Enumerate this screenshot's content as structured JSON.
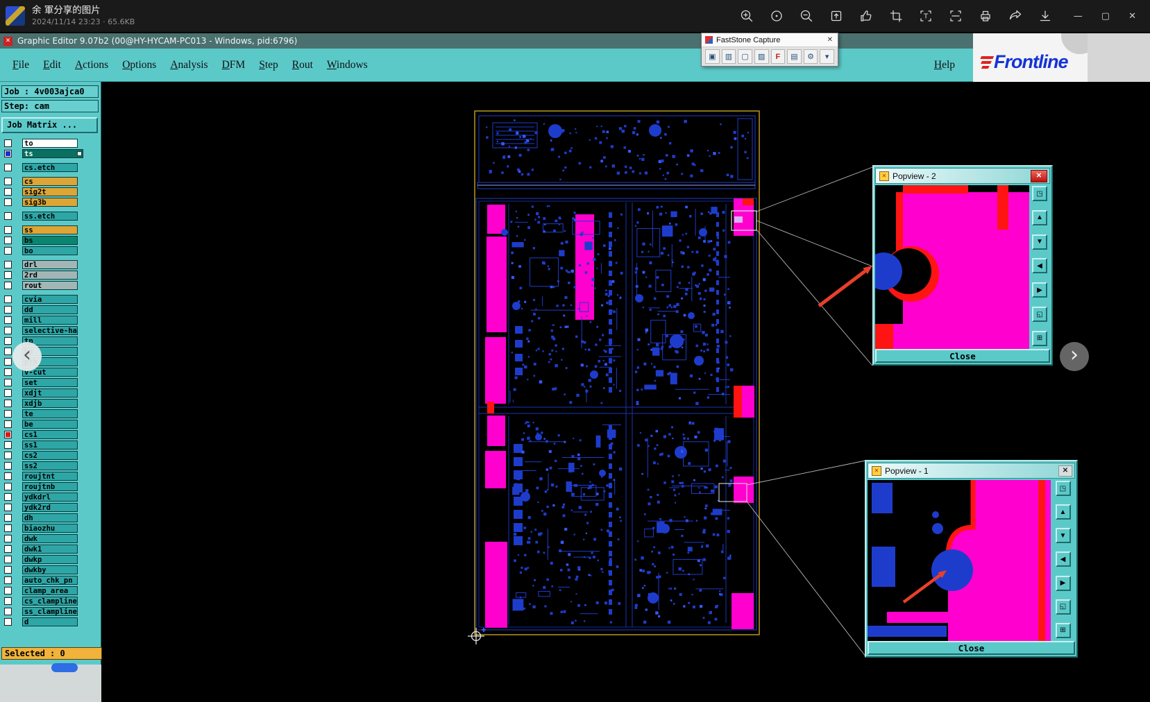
{
  "viewer": {
    "title": "余 軍分享的图片",
    "subtitle": "2024/11/14 23:23 · 65.6KB",
    "toolbar_icons": [
      "zoom-in",
      "actual-size",
      "zoom-out",
      "open-with",
      "thumbs-up",
      "crop",
      "ocr",
      "scan",
      "print",
      "share",
      "download"
    ],
    "window_buttons": [
      {
        "name": "minimize",
        "glyph": "—"
      },
      {
        "name": "maximize",
        "glyph": "▢"
      },
      {
        "name": "close",
        "glyph": "✕"
      }
    ],
    "nav_prev": "‹",
    "nav_next": "›"
  },
  "editor": {
    "titlebar": "Graphic Editor 9.07b2 (00@HY-HYCAM-PC013 - Windows, pid:6796)",
    "title_icon": "✕",
    "menus": [
      "File",
      "Edit",
      "Actions",
      "Options",
      "Analysis",
      "DFM",
      "Step",
      "Rout",
      "Windows"
    ],
    "help": "Help",
    "brand": "Frontline"
  },
  "faststone": {
    "title": "FastStone Capture",
    "close_glyph": "✕",
    "icons": [
      {
        "name": "capture-screen",
        "glyph": "▣"
      },
      {
        "name": "capture-window",
        "glyph": "▥"
      },
      {
        "name": "capture-region",
        "glyph": "▢"
      },
      {
        "name": "capture-freehand",
        "glyph": "▨"
      },
      {
        "name": "capture-fixed",
        "glyph": "F"
      },
      {
        "name": "save",
        "glyph": "▤"
      },
      {
        "name": "settings",
        "glyph": "⚙"
      },
      {
        "name": "more",
        "glyph": "▾"
      }
    ]
  },
  "sidebar": {
    "job_label": "Job : 4v003ajca0",
    "step_label": "Step: cam",
    "matrix_button": "Job Matrix ...",
    "selected_label": "Selected : 0",
    "layers": [
      {
        "n": "to",
        "c": "white"
      },
      {
        "n": "ts",
        "c": "sel",
        "cb": "blue"
      },
      {
        "n": "cs.etch",
        "c": "teal",
        "g": true
      },
      {
        "n": "cs",
        "c": "orange",
        "g": true
      },
      {
        "n": "sig2t",
        "c": "orange"
      },
      {
        "n": "sig3b",
        "c": "orange"
      },
      {
        "n": "ss.etch",
        "c": "teal",
        "g": true
      },
      {
        "n": "ss",
        "c": "orange",
        "g": true
      },
      {
        "n": "bs",
        "c": "green"
      },
      {
        "n": "bo",
        "c": "teal"
      },
      {
        "n": "drl",
        "c": "gray",
        "g": true
      },
      {
        "n": "2rd",
        "c": "gray"
      },
      {
        "n": "rout",
        "c": "gray"
      },
      {
        "n": "cvia",
        "c": "teal",
        "g": true
      },
      {
        "n": "dd",
        "c": "teal"
      },
      {
        "n": "mill",
        "c": "teal"
      },
      {
        "n": "selective-ha",
        "c": "teal"
      },
      {
        "n": "tp",
        "c": "teal"
      },
      {
        "n": "bp",
        "c": "teal"
      },
      {
        "n": "pth",
        "c": "teal"
      },
      {
        "n": "v-cut",
        "c": "teal"
      },
      {
        "n": "set",
        "c": "teal"
      },
      {
        "n": "xdjt",
        "c": "teal"
      },
      {
        "n": "xdjb",
        "c": "teal"
      },
      {
        "n": "te",
        "c": "teal"
      },
      {
        "n": "be",
        "c": "teal"
      },
      {
        "n": "cs1",
        "c": "teal",
        "cb": "red"
      },
      {
        "n": "ss1",
        "c": "teal"
      },
      {
        "n": "cs2",
        "c": "teal"
      },
      {
        "n": "ss2",
        "c": "teal"
      },
      {
        "n": "roujtnt",
        "c": "teal"
      },
      {
        "n": "roujtnb",
        "c": "teal"
      },
      {
        "n": "ydkdrl",
        "c": "teal"
      },
      {
        "n": "ydk2rd",
        "c": "teal"
      },
      {
        "n": "dh",
        "c": "teal"
      },
      {
        "n": "biaozhu",
        "c": "teal"
      },
      {
        "n": "dwk",
        "c": "teal"
      },
      {
        "n": "dwk1",
        "c": "teal"
      },
      {
        "n": "dwkp",
        "c": "teal"
      },
      {
        "n": "dwkby",
        "c": "teal"
      },
      {
        "n": "auto_chk_pn",
        "c": "teal"
      },
      {
        "n": "clamp_area",
        "c": "teal"
      },
      {
        "n": "cs_clampline",
        "c": "teal"
      },
      {
        "n": "ss_clampline",
        "c": "teal"
      },
      {
        "n": "d",
        "c": "teal"
      }
    ]
  },
  "popviews": [
    {
      "title": "Popview - 2",
      "close_label": "Close",
      "close_glyph": "✕"
    },
    {
      "title": "Popview - 1",
      "close_label": "Close",
      "close_glyph": "✕"
    }
  ],
  "popview_tools": [
    {
      "name": "open-view",
      "glyph": "◳"
    },
    {
      "name": "pan-up",
      "glyph": "▲"
    },
    {
      "name": "pan-down",
      "glyph": "▼"
    },
    {
      "name": "pan-left",
      "glyph": "◀"
    },
    {
      "name": "pan-right",
      "glyph": "▶"
    },
    {
      "name": "zoom-fit",
      "glyph": "◱"
    },
    {
      "name": "zoom-select",
      "glyph": "⊞"
    }
  ],
  "colors": {
    "accent_teal": "#5cc9c9",
    "layer_teal": "#2ea6a6",
    "layer_orange": "#dca535",
    "layer_green": "#0b8570",
    "pcb_blue": "#1e3ccc",
    "pcb_magenta": "#ff00cf",
    "pcb_red": "#ff1414",
    "board_outline": "#c7a21f",
    "selected_bar": "#f2b33c"
  }
}
